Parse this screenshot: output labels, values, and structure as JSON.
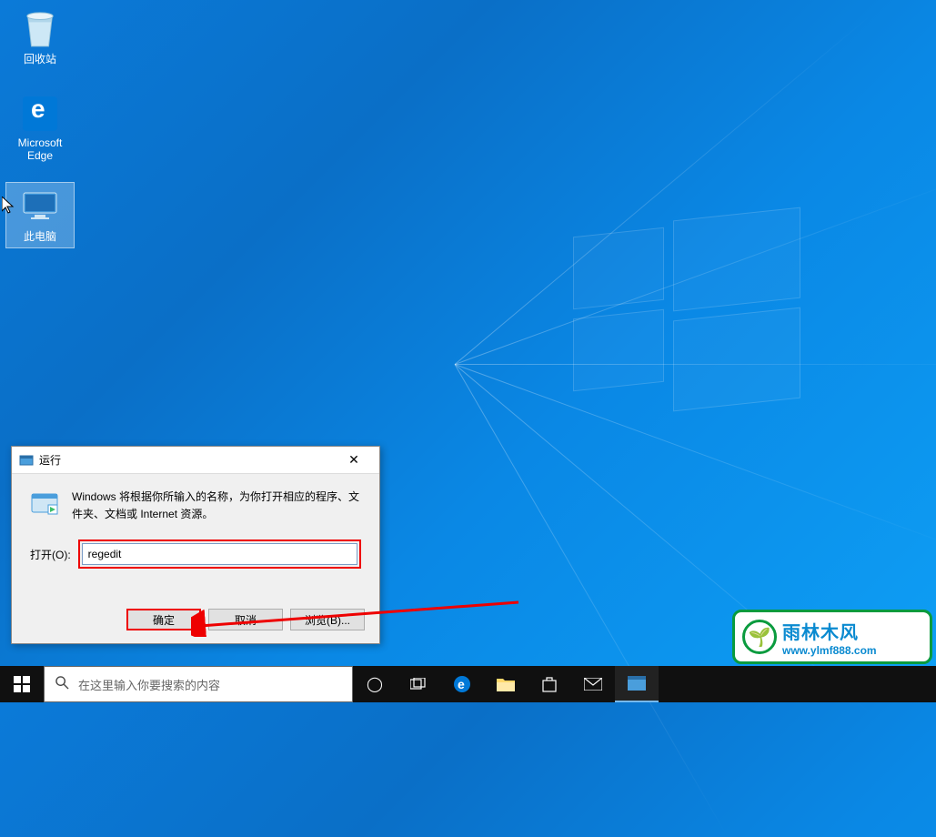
{
  "desktop": {
    "icons": {
      "recycle_bin": "回收站",
      "edge": "Microsoft\nEdge",
      "this_pc": "此电脑"
    }
  },
  "run_dialog": {
    "title": "运行",
    "description": "Windows 将根据你所输入的名称，为你打开相应的程序、文件夹、文档或 Internet 资源。",
    "open_label": "打开(O):",
    "input_value": "regedit",
    "buttons": {
      "ok": "确定",
      "cancel": "取消",
      "browse": "浏览(B)..."
    }
  },
  "taskbar": {
    "search_placeholder": "在这里输入你要搜索的内容"
  },
  "watermark": {
    "cn": "雨林木风",
    "url": "www.ylmf888.com",
    "icon_glyph": "🌱"
  },
  "icons": {
    "close": "✕",
    "search": "🔍",
    "cortana": "◯",
    "taskview": "⧉",
    "edge": "e",
    "explorer": "📁",
    "store": "🛍",
    "mail": "✉",
    "run": "▦"
  }
}
